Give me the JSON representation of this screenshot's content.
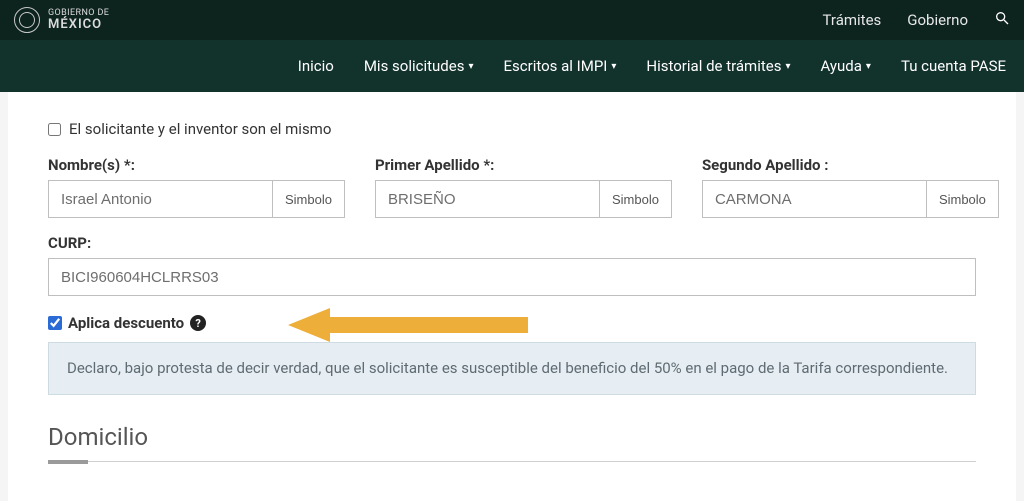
{
  "topbar": {
    "gov_line1": "GOBIERNO DE",
    "gov_line2": "MÉXICO",
    "link_tramites": "Trámites",
    "link_gobierno": "Gobierno"
  },
  "nav": {
    "inicio": "Inicio",
    "mis_solicitudes": "Mis solicitudes",
    "escritos": "Escritos al IMPI",
    "historial": "Historial de trámites",
    "ayuda": "Ayuda",
    "cuenta": "Tu cuenta PASE"
  },
  "form": {
    "same_person_label": "El solicitante y el inventor son el mismo",
    "nombres_label": "Nombre(s) *:",
    "nombres_value": "Israel Antonio",
    "primer_apellido_label": "Primer Apellido *:",
    "primer_apellido_value": "BRISEÑO",
    "segundo_apellido_label": "Segundo Apellido :",
    "segundo_apellido_value": "CARMONA",
    "simbolo_btn": "Simbolo",
    "curp_label": "CURP:",
    "curp_value": "BICI960604HCLRRS03",
    "discount_label": "Aplica descuento",
    "discount_help": "?",
    "declaration": "Declaro, bajo protesta de decir verdad, que el solicitante es susceptible del beneficio del 50% en el pago de la Tarifa correspondiente.",
    "domicilio_heading": "Domicilio"
  }
}
